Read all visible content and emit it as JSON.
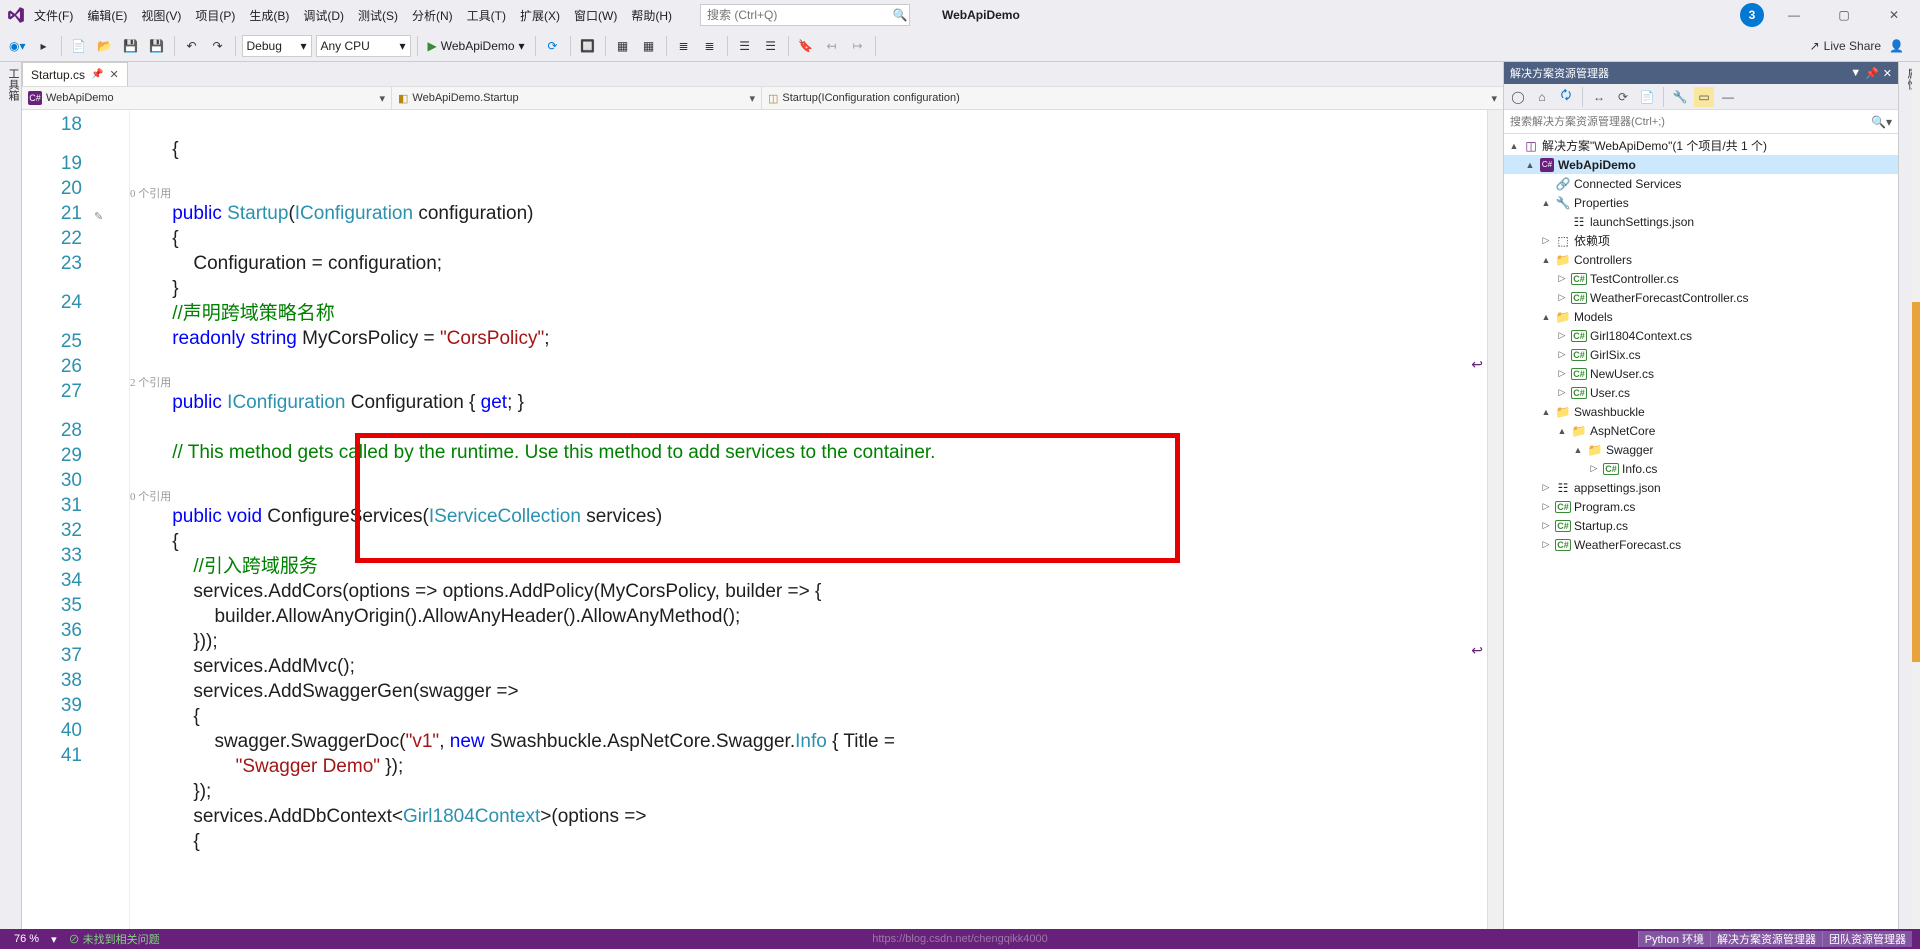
{
  "titlebar": {
    "menu": [
      "文件(F)",
      "编辑(E)",
      "视图(V)",
      "项目(P)",
      "生成(B)",
      "调试(D)",
      "测试(S)",
      "分析(N)",
      "工具(T)",
      "扩展(X)",
      "窗口(W)",
      "帮助(H)"
    ],
    "search_placeholder": "搜索 (Ctrl+Q)",
    "project": "WebApiDemo",
    "user_badge": "3"
  },
  "toolbar": {
    "config": "Debug",
    "platform": "Any CPU",
    "run_target": "WebApiDemo",
    "live_share": "Live Share"
  },
  "left_rail": "工具箱",
  "right_rail": "属性",
  "tab": {
    "name": "Startup.cs"
  },
  "navbar": {
    "scope1": "WebApiDemo",
    "scope2": "WebApiDemo.Startup",
    "scope3": "Startup(IConfiguration configuration)"
  },
  "gutter_lines": [
    "18",
    "19",
    "20",
    "21",
    "22",
    "23",
    "24",
    "25",
    "26",
    "27",
    "28",
    "29",
    "30",
    "31",
    "32",
    "33",
    "34",
    "35",
    "36",
    "37",
    "38",
    "39",
    "40",
    "41"
  ],
  "refs": {
    "zero": "0 个引用",
    "two": "2 个引用"
  },
  "code": {
    "l19a": "public",
    "l19b": "Startup",
    "l19c": "IConfiguration",
    "l19d": " configuration)",
    "l21": "            Configuration = configuration;",
    "l23": "//声明跨域策略名称",
    "l24a": "readonly",
    "l24b": "string",
    "l24c": " MyCorsPolicy = ",
    "l24d": "\"CorsPolicy\"",
    "l24e": ";",
    "l25a": "public",
    "l25b": "IConfiguration",
    "l25c": " Configuration { ",
    "l25d": "get",
    "l25e": "; }",
    "l27": "// This method gets called by the runtime. Use this method to add services to the container.",
    "l28a": "public",
    "l28b": "void",
    "l28c": " ConfigureServices(",
    "l28d": "IServiceCollection",
    "l28e": " services)",
    "l30": "//引入跨域服务",
    "l31": "            services.AddCors(options => options.AddPolicy(MyCorsPolicy, builder => {",
    "l32": "                builder.AllowAnyOrigin().AllowAnyHeader().AllowAnyMethod();",
    "l33": "            }));",
    "l34": "            services.AddMvc();",
    "l35": "            services.AddSwaggerGen(swagger =>",
    "l37a": "                swagger.SwaggerDoc(",
    "l37b": "\"v1\"",
    "l37c": ", ",
    "l37d": "new",
    "l37e": " Swashbuckle.AspNetCore.Swagger.",
    "l37f": "Info",
    "l37g": " { Title = ",
    "l37h": "\"Swagger Demo\"",
    "l37i": " });",
    "l38": "            });",
    "l39a": "            services.AddDbContext<",
    "l39b": "Girl1804Context",
    "l39c": ">(options =>"
  },
  "solution": {
    "title": "解决方案资源管理器",
    "search_placeholder": "搜索解决方案资源管理器(Ctrl+;)",
    "root": "解决方案\"WebApiDemo\"(1 个项目/共 1 个)",
    "tree": [
      {
        "depth": 1,
        "arr": "▲",
        "ico": "cs",
        "label": "WebApiDemo",
        "bold": true,
        "sel": true
      },
      {
        "depth": 2,
        "arr": "",
        "ico": "link",
        "label": "Connected Services"
      },
      {
        "depth": 2,
        "arr": "▲",
        "ico": "wrench",
        "label": "Properties"
      },
      {
        "depth": 3,
        "arr": "",
        "ico": "json",
        "label": "launchSettings.json"
      },
      {
        "depth": 2,
        "arr": "▷",
        "ico": "ref",
        "label": "依赖项"
      },
      {
        "depth": 2,
        "arr": "▲",
        "ico": "folder",
        "label": "Controllers"
      },
      {
        "depth": 3,
        "arr": "▷",
        "ico": "csf",
        "label": "TestController.cs"
      },
      {
        "depth": 3,
        "arr": "▷",
        "ico": "csf",
        "label": "WeatherForecastController.cs"
      },
      {
        "depth": 2,
        "arr": "▲",
        "ico": "folder",
        "label": "Models"
      },
      {
        "depth": 3,
        "arr": "▷",
        "ico": "csf",
        "label": "Girl1804Context.cs"
      },
      {
        "depth": 3,
        "arr": "▷",
        "ico": "csf",
        "label": "GirlSix.cs"
      },
      {
        "depth": 3,
        "arr": "▷",
        "ico": "csf",
        "label": "NewUser.cs"
      },
      {
        "depth": 3,
        "arr": "▷",
        "ico": "csf",
        "label": "User.cs"
      },
      {
        "depth": 2,
        "arr": "▲",
        "ico": "folder",
        "label": "Swashbuckle"
      },
      {
        "depth": 3,
        "arr": "▲",
        "ico": "folder",
        "label": "AspNetCore"
      },
      {
        "depth": 4,
        "arr": "▲",
        "ico": "folder",
        "label": "Swagger"
      },
      {
        "depth": 5,
        "arr": "▷",
        "ico": "csf",
        "label": "Info.cs"
      },
      {
        "depth": 2,
        "arr": "▷",
        "ico": "json",
        "label": "appsettings.json"
      },
      {
        "depth": 2,
        "arr": "▷",
        "ico": "csf",
        "label": "Program.cs"
      },
      {
        "depth": 2,
        "arr": "▷",
        "ico": "csf",
        "label": "Startup.cs"
      },
      {
        "depth": 2,
        "arr": "▷",
        "ico": "csf",
        "label": "WeatherForecast.cs"
      }
    ]
  },
  "watermark": "https://blog.csdn.net/chengqikk4000",
  "status": {
    "zoom": "76 %",
    "noissues": "未找到相关问题",
    "right": [
      "Python 环境",
      "解决方案资源管理器",
      "团队资源管理器"
    ]
  }
}
